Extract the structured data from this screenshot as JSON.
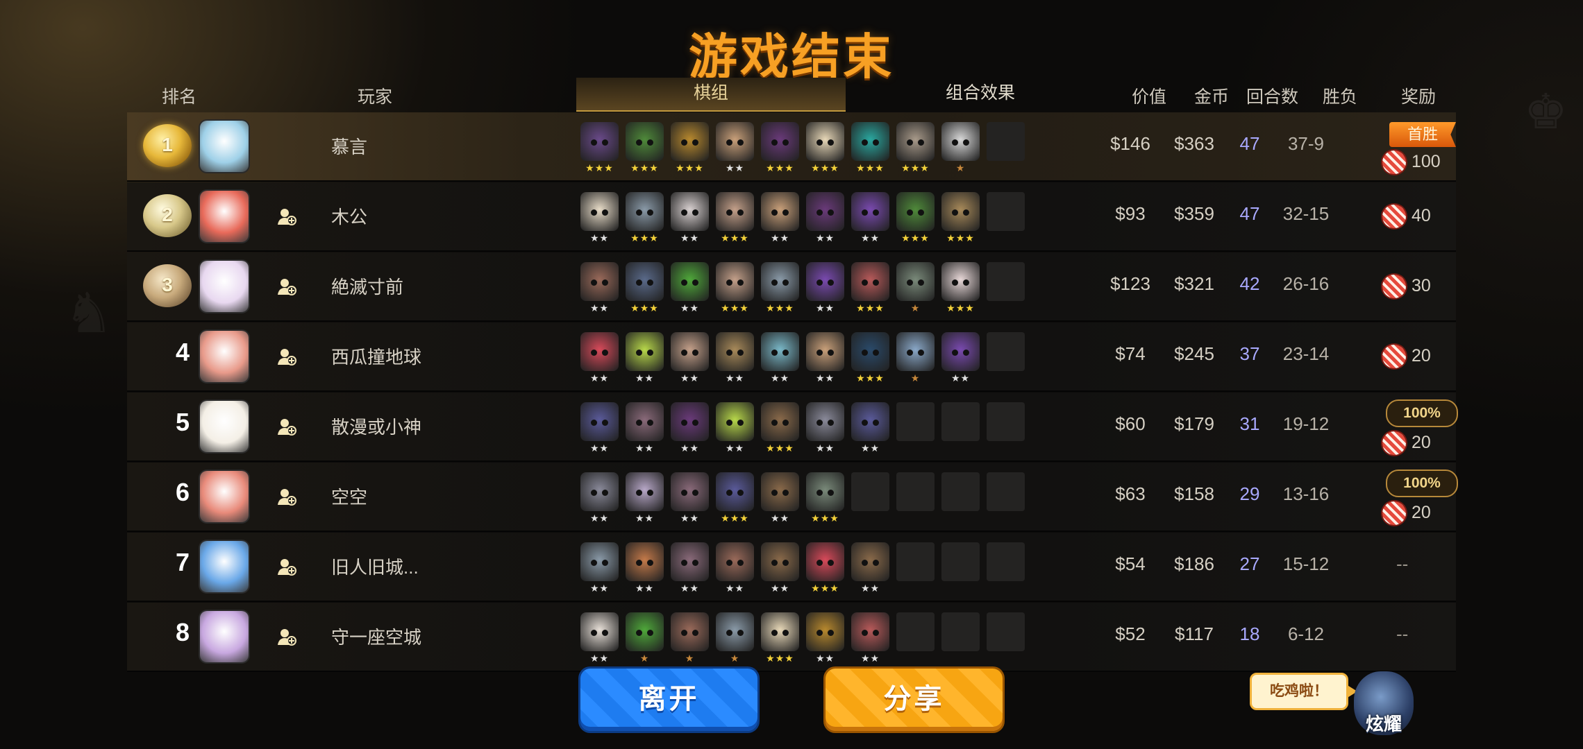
{
  "title": "游戏结束",
  "headers": {
    "rank": "排名",
    "player": "玩家",
    "value": "价值",
    "gold": "金币",
    "rounds": "回合数",
    "winloss": "胜负",
    "reward": "奖励"
  },
  "tabs": {
    "lineup": "棋组",
    "synergy": "组合效果"
  },
  "rows": [
    {
      "rank": "1",
      "medal": "gold",
      "name": "慕言",
      "value": "$146",
      "gold": "$363",
      "rounds": "47",
      "wl": "37-9",
      "reward": {
        "ribbon": "首胜",
        "candy": "100"
      },
      "units": [
        [
          "#6a4a8a",
          "★★★",
          "g2"
        ],
        [
          "#4f8a3a",
          "★★★",
          "g2"
        ],
        [
          "#b8892e",
          "★★★",
          "g2"
        ],
        [
          "#c9a07a",
          "★★",
          "g1"
        ],
        [
          "#6a3a7a",
          "★★★",
          "g2"
        ],
        [
          "#e8d8b8",
          "★★★",
          "g2"
        ],
        [
          "#2aa8a0",
          "★★★",
          "g2"
        ],
        [
          "#a89a8a",
          "★★★",
          "g2"
        ],
        [
          "#d8d8d8",
          "★",
          "g3"
        ]
      ],
      "slots": 1
    },
    {
      "rank": "2",
      "medal": "silver",
      "name": "木公",
      "value": "$93",
      "gold": "$359",
      "rounds": "47",
      "wl": "32-15",
      "reward": {
        "candy": "40"
      },
      "units": [
        [
          "#e8dcc8",
          "★★",
          "g1"
        ],
        [
          "#8a9aa8",
          "★★★",
          "g2"
        ],
        [
          "#d8d0d0",
          "★★",
          "g1"
        ],
        [
          "#c4a08a",
          "★★★",
          "g2"
        ],
        [
          "#c9a07a",
          "★★",
          "g1"
        ],
        [
          "#6a3a7a",
          "★★",
          "g1"
        ],
        [
          "#7a4ab0",
          "★★",
          "g1"
        ],
        [
          "#4f8a3a",
          "★★★",
          "g2"
        ],
        [
          "#a88a5a",
          "★★★",
          "g2"
        ]
      ],
      "slots": 1
    },
    {
      "rank": "3",
      "medal": "bronze",
      "name": "絶滅寸前",
      "value": "$123",
      "gold": "$321",
      "rounds": "42",
      "wl": "26-16",
      "reward": {
        "candy": "30"
      },
      "units": [
        [
          "#9a6a5a",
          "★★",
          "g1"
        ],
        [
          "#5a6a8a",
          "★★★",
          "g2"
        ],
        [
          "#4fa83a",
          "★★",
          "g1"
        ],
        [
          "#c4a08a",
          "★★★",
          "g2"
        ],
        [
          "#8a9aa8",
          "★★★",
          "g2"
        ],
        [
          "#7a4ab0",
          "★★",
          "g1"
        ],
        [
          "#b85a5a",
          "★★★",
          "g2"
        ],
        [
          "#7a8a7a",
          "★",
          "g3"
        ],
        [
          "#e8d8d8",
          "★★★",
          "g2"
        ]
      ],
      "slots": 1
    },
    {
      "rank": "4",
      "medal": "",
      "name": "西瓜撞地球",
      "value": "$74",
      "gold": "$245",
      "rounds": "37",
      "wl": "23-14",
      "reward": {
        "candy": "20"
      },
      "units": [
        [
          "#d84a5a",
          "★★",
          "g1"
        ],
        [
          "#b8d84a",
          "★★",
          "g1"
        ],
        [
          "#c4a08a",
          "★★",
          "g1"
        ],
        [
          "#a88a5a",
          "★★",
          "g1"
        ],
        [
          "#7ab8c8",
          "★★",
          "g1"
        ],
        [
          "#c9a07a",
          "★★",
          "g1"
        ],
        [
          "#2a4a6a",
          "★★★",
          "g2"
        ],
        [
          "#8aa8c8",
          "★",
          "g3"
        ],
        [
          "#7a4ab0",
          "★★",
          "g1"
        ]
      ],
      "slots": 1
    },
    {
      "rank": "5",
      "medal": "",
      "name": "散漫或小神",
      "value": "$60",
      "gold": "$179",
      "rounds": "31",
      "wl": "19-12",
      "reward": {
        "badge": "100%",
        "candy": "20"
      },
      "units": [
        [
          "#5a5a9a",
          "★★",
          "g1"
        ],
        [
          "#8a6a7a",
          "★★",
          "g1"
        ],
        [
          "#6a3a7a",
          "★★",
          "g1"
        ],
        [
          "#b8d84a",
          "★★",
          "g1"
        ],
        [
          "#8a6a4a",
          "★★★",
          "g2"
        ],
        [
          "#8a8a9a",
          "★★",
          "g1"
        ],
        [
          "#5a5a9a",
          "★★",
          "g1"
        ]
      ],
      "slots": 3
    },
    {
      "rank": "6",
      "medal": "",
      "name": "空空",
      "value": "$63",
      "gold": "$158",
      "rounds": "29",
      "wl": "13-16",
      "reward": {
        "badge": "100%",
        "candy": "20"
      },
      "units": [
        [
          "#8a8a9a",
          "★★",
          "g1"
        ],
        [
          "#b8a8c8",
          "★★",
          "g1"
        ],
        [
          "#8a6a7a",
          "★★",
          "g1"
        ],
        [
          "#5a5a9a",
          "★★★",
          "g2"
        ],
        [
          "#8a6a4a",
          "★★",
          "g1"
        ],
        [
          "#7a8a7a",
          "★★★",
          "g2"
        ]
      ],
      "slots": 4
    },
    {
      "rank": "7",
      "medal": "",
      "name": "旧人旧城...",
      "value": "$54",
      "gold": "$186",
      "rounds": "27",
      "wl": "15-12",
      "reward": {
        "dash": "--"
      },
      "units": [
        [
          "#8a9aa8",
          "★★",
          "g1"
        ],
        [
          "#c47a4a",
          "★★",
          "g1"
        ],
        [
          "#8a6a7a",
          "★★",
          "g1"
        ],
        [
          "#9a6a5a",
          "★★",
          "g1"
        ],
        [
          "#8a6a4a",
          "★★",
          "g1"
        ],
        [
          "#d84a5a",
          "★★★",
          "g2"
        ],
        [
          "#8a6a4a",
          "★★",
          "g1"
        ]
      ],
      "slots": 3
    },
    {
      "rank": "8",
      "medal": "",
      "name": "守一座空城",
      "value": "$52",
      "gold": "$117",
      "rounds": "18",
      "wl": "6-12",
      "reward": {
        "dash": "--"
      },
      "units": [
        [
          "#e8e0d8",
          "★★",
          "g1"
        ],
        [
          "#4fa83a",
          "★",
          "g3"
        ],
        [
          "#9a6a5a",
          "★",
          "g3"
        ],
        [
          "#8a9aa8",
          "★",
          "g3"
        ],
        [
          "#e8d8b8",
          "★★★",
          "g2"
        ],
        [
          "#b8892e",
          "★★",
          "g1"
        ],
        [
          "#b85a5a",
          "★★",
          "g1"
        ]
      ],
      "slots": 3
    }
  ],
  "avatars": [
    "#9ed0e8",
    "#e86a5a",
    "#e8d8f0",
    "#e89a8a",
    "#f4efe6",
    "#e88a7a",
    "#6aa8e8",
    "#c8a8e0"
  ],
  "buttons": {
    "leave": "离开",
    "share": "分享"
  },
  "bubble": "吃鸡啦！",
  "mascot_label": "炫耀"
}
